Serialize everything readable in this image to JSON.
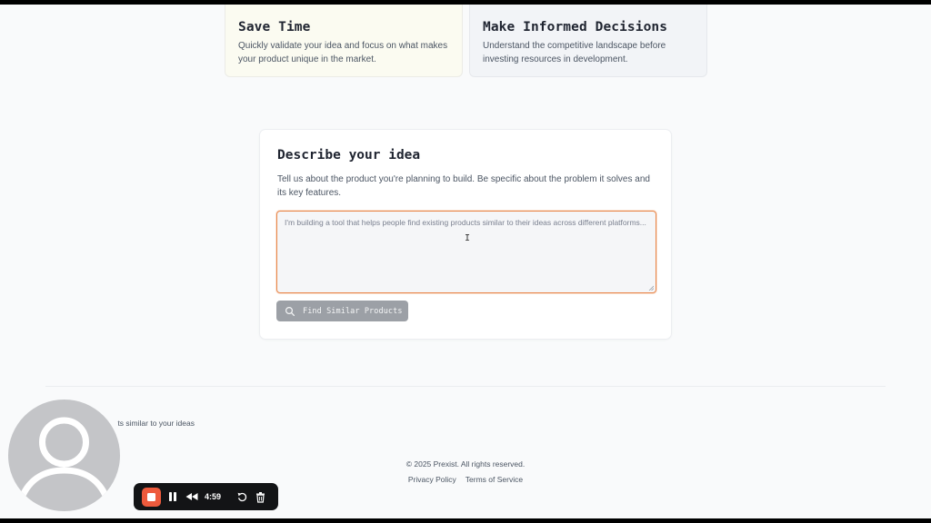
{
  "features": [
    {
      "title": "Save Time",
      "description": "Quickly validate your idea and focus on what makes your product unique in the market."
    },
    {
      "title": "Make Informed Decisions",
      "description": "Understand the competitive landscape before investing resources in development."
    }
  ],
  "idea_form": {
    "title": "Describe your idea",
    "description": "Tell us about the product you're planning to build. Be specific about the problem it solves and its key features.",
    "textarea_value": "",
    "textarea_placeholder": "I'm building a tool that helps people find existing products similar to their ideas across different platforms...",
    "submit_label": "Find Similar Products"
  },
  "footer": {
    "tagline_partial": "ts similar to your ideas",
    "copyright": "© 2025 Prexist. All rights reserved.",
    "links": [
      "Privacy Policy",
      "Terms of Service"
    ]
  },
  "recorder": {
    "timer": "4:59",
    "stop_color": "#ee5a3c",
    "icons": [
      "stop-icon",
      "pause-icon",
      "rewind-icon",
      "restart-icon",
      "trash-icon"
    ]
  },
  "colors": {
    "focus_border": "#e9874a",
    "button_disabled": "#9ca0a6"
  }
}
